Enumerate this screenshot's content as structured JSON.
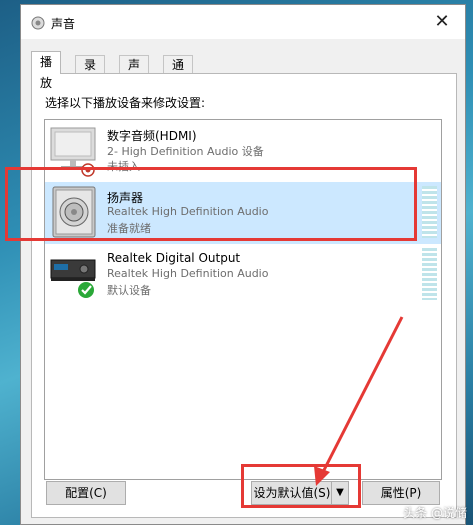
{
  "window": {
    "title": "声音",
    "close_glyph": "✕"
  },
  "tabs": [
    {
      "label": "播放"
    },
    {
      "label": "录制"
    },
    {
      "label": "声音"
    },
    {
      "label": "通信"
    }
  ],
  "panel": {
    "instruction": "选择以下播放设备来修改设置:"
  },
  "devices": [
    {
      "name": "数字音频(HDMI)",
      "description": "2- High Definition Audio 设备",
      "status": "未插入",
      "icon": "monitor-icon",
      "status_icon": "unplugged-badge-icon"
    },
    {
      "name": "扬声器",
      "description": "Realtek High Definition Audio",
      "status": "准备就绪",
      "icon": "speaker-icon"
    },
    {
      "name": "Realtek Digital Output",
      "description": "Realtek High Definition Audio",
      "status": "默认设备",
      "icon": "digital-output-icon",
      "status_icon": "default-checkmark-icon"
    }
  ],
  "buttons": {
    "configure": "配置(C)",
    "set_default": "设为默认值(S)",
    "set_default_arrow": "▼",
    "properties": "属性(P)"
  },
  "watermark": "头条 @说储",
  "colors": {
    "annotation": "#e53935",
    "selection": "#cce8ff",
    "default_check": "#2aa838"
  }
}
